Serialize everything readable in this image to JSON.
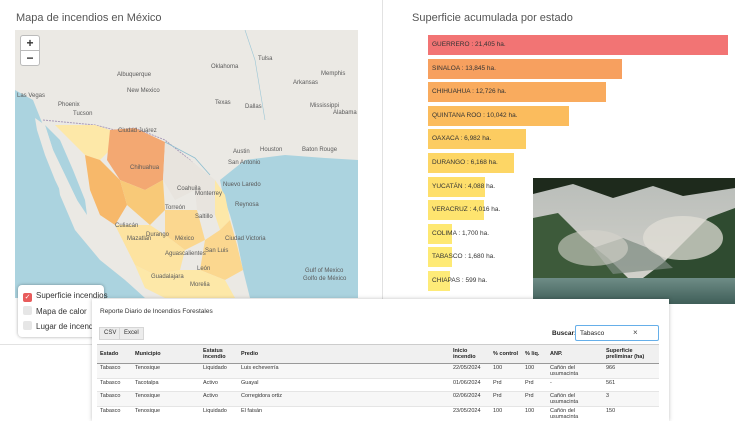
{
  "map_panel": {
    "title": "Mapa de incendios en México",
    "zoom_in": "+",
    "zoom_out": "−",
    "labels": [
      "Tulsa",
      "Oklahoma",
      "Memphis",
      "Albuquerque",
      "Arkansas",
      "New Mexico",
      "Texas",
      "Dallas",
      "Phoenix",
      "Tucson",
      "Ciudad Juárez",
      "Mississippi",
      "Alabama",
      "Houston",
      "Baton Rouge",
      "Austin",
      "San Antonio",
      "Chihuahua",
      "Coahuila",
      "Nuevo Laredo",
      "Monterrey",
      "Reynosa",
      "Culiacán",
      "Mazatlán",
      "Durango",
      "Torreón",
      "Saltillo",
      "México",
      "Aguascalientes",
      "San Luis",
      "Ciudad Victoria",
      "Guadalajara",
      "Morelia",
      "León",
      "Gulf of Mexico",
      "Golfo de México",
      "Las Vegas"
    ],
    "layers": [
      {
        "label": "Superficie incendios",
        "checked": true
      },
      {
        "label": "Mapa de calor",
        "checked": false
      },
      {
        "label": "Lugar de incendios",
        "checked": false
      }
    ]
  },
  "chart_panel": {
    "title": "Superficie acumulada por estado"
  },
  "chart_data": {
    "type": "bar",
    "title": "Superficie acumulada por estado",
    "orientation": "horizontal",
    "categories": [
      "GUERRERO",
      "SINALOA",
      "CHIHUAHUA",
      "QUINTANA ROO",
      "OAXACA",
      "DURANGO",
      "YUCATÁN",
      "VERACRUZ",
      "COLIMA",
      "TABASCO",
      "CHIAPAS"
    ],
    "values": [
      21405,
      13845,
      12726,
      10042,
      6982,
      6168,
      4088,
      4016,
      1700,
      1680,
      599
    ],
    "labels": [
      "GUERRERO : 21,405 ha.",
      "SINALOA : 13,845 ha.",
      "CHIHUAHUA : 12,726 ha.",
      "QUINTANA ROO : 10,042 ha.",
      "OAXACA : 6,982 ha.",
      "DURANGO : 6,168 ha.",
      "YUCATÁN : 4,088 ha.",
      "VERACRUZ : 4,016 ha.",
      "COLIMA : 1,700 ha.",
      "TABASCO : 1,680 ha.",
      "CHIAPAS : 599 ha."
    ],
    "colors": [
      "#f27474",
      "#f7a05f",
      "#f9ab5e",
      "#fbbc5d",
      "#fccc61",
      "#fdd665",
      "#fedf6b",
      "#fee46f",
      "#fee872",
      "#feea75",
      "#feeb78"
    ],
    "xlim": [
      0,
      21405
    ]
  },
  "report": {
    "title": "Reporte Diario de Incendios Forestales",
    "buttons": [
      "CSV",
      "Excel"
    ],
    "search_label": "Buscar:",
    "search_value": "Tabasco",
    "clear_icon": "×",
    "columns": [
      "Estado",
      "Municipio",
      "Estatus incendio",
      "Predio",
      "Inicio incendio",
      "% control",
      "% liq.",
      "ANP.",
      "Superficie preliminar (ha)"
    ],
    "rows": [
      [
        "Tabasco",
        "Tenosique",
        "Liquidado",
        "Luis echeverría",
        "22/05/2024",
        "100",
        "100",
        "Cañón del usumacinta",
        "966"
      ],
      [
        "Tabasco",
        "Tacotalpa",
        "Activo",
        "Guayal",
        "01/06/2024",
        "Prd",
        "Prd",
        "-",
        "561"
      ],
      [
        "Tabasco",
        "Tenosique",
        "Activo",
        "Corregidora ortiz",
        "02/06/2024",
        "Prd",
        "Prd",
        "Cañón del usumacinta",
        "3"
      ],
      [
        "Tabasco",
        "Tenosique",
        "Liquidado",
        "El faisán",
        "23/05/2024",
        "100",
        "100",
        "Cañón del usumacinta",
        "150"
      ]
    ]
  }
}
